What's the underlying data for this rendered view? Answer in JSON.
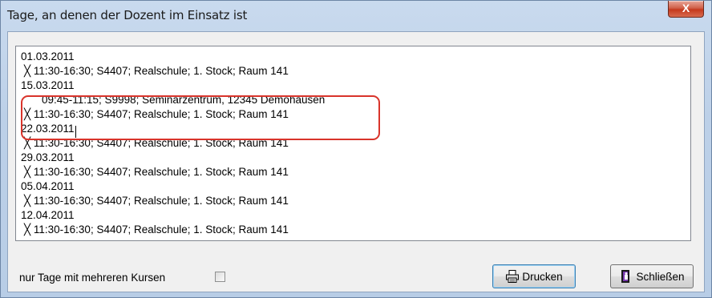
{
  "window": {
    "title": "Tage, an denen der Dozent im Einsatz ist",
    "close_glyph": "X"
  },
  "list": {
    "lines": [
      {
        "type": "date",
        "text": "01.03.2011"
      },
      {
        "type": "entry",
        "text": "╳ 11:30-16:30; S4407; Realschule; 1. Stock; Raum 141"
      },
      {
        "type": "date",
        "text": "15.03.2011"
      },
      {
        "type": "entry-indent",
        "text": "09:45-11:15; S9998; Seminarzentrum, 12345 Demohausen"
      },
      {
        "type": "entry",
        "text": "╳ 11:30-16:30; S4407; Realschule; 1. Stock; Raum 141"
      },
      {
        "type": "date",
        "text": "22.03.2011"
      },
      {
        "type": "entry",
        "text": "╳ 11:30-16:30; S4407; Realschule; 1. Stock; Raum 141"
      },
      {
        "type": "date",
        "text": "29.03.2011"
      },
      {
        "type": "entry",
        "text": "╳ 11:30-16:30; S4407; Realschule; 1. Stock; Raum 141"
      },
      {
        "type": "date",
        "text": "05.04.2011"
      },
      {
        "type": "entry",
        "text": "╳ 11:30-16:30; S4407; Realschule; 1. Stock; Raum 141"
      },
      {
        "type": "date",
        "text": "12.04.2011"
      },
      {
        "type": "entry",
        "text": "╳ 11:30-16:30; S4407; Realschule; 1. Stock; Raum 141"
      }
    ]
  },
  "footer": {
    "checkbox_label": "nur Tage mit mehreren Kursen",
    "checkbox_checked": false,
    "print_label": "Drucken",
    "close_label": "Schließen",
    "print_icon": "printer-icon",
    "close_icon": "exit-door-icon"
  },
  "colors": {
    "highlight_border": "#d9342b",
    "close_button": "#c5391c"
  }
}
